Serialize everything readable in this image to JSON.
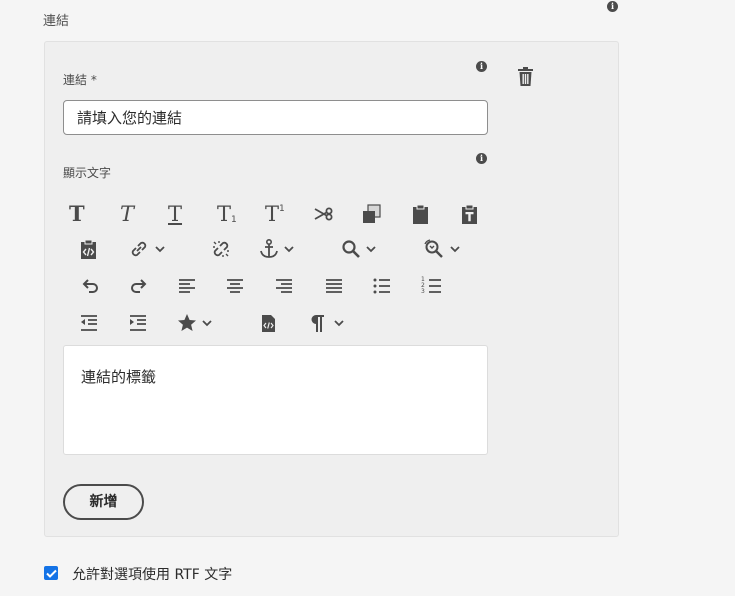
{
  "section": {
    "title": "連結"
  },
  "link_field": {
    "label": "連結 *",
    "placeholder": "請填入您的連結"
  },
  "display_text": {
    "label": "顯示文字",
    "content": "連結的標籤"
  },
  "toolbar": {
    "superscript_mark": "1",
    "subscript_mark": "1",
    "ordered_list_numbers": "1 2 3"
  },
  "add_button": {
    "label": "新增"
  },
  "rich_text_option": {
    "label": "允許對選項使用 RTF 文字",
    "checked": true
  },
  "colors": {
    "accent": "#1473e6",
    "icon": "#4b4b4b",
    "panel": "#efefef",
    "page": "#f5f5f5"
  }
}
